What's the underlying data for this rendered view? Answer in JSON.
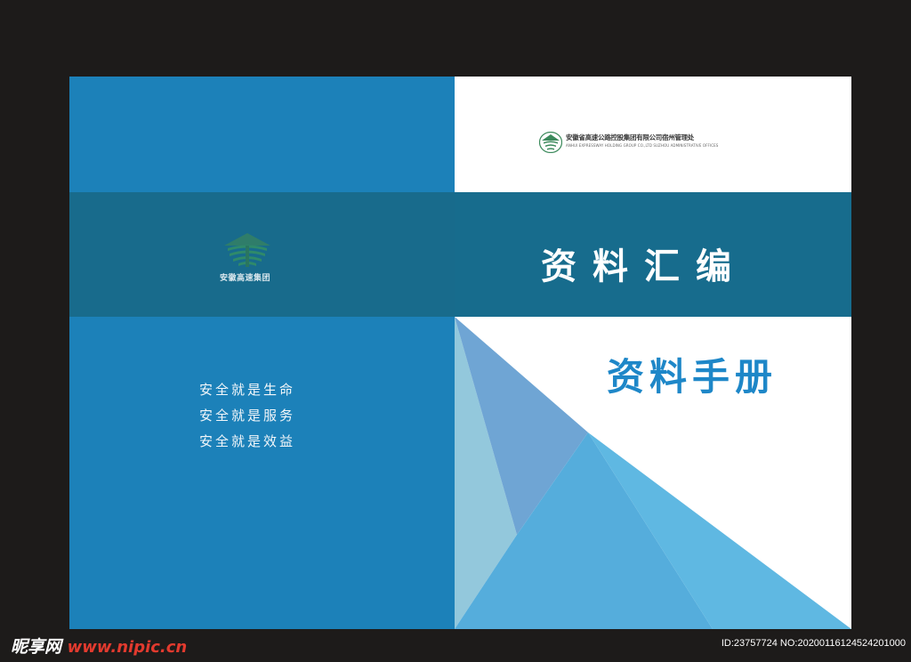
{
  "back_cover": {
    "group_name": "安徽高速集团",
    "slogans": [
      "安全就是生命",
      "安全就是服务",
      "安全就是效益"
    ]
  },
  "front_cover": {
    "publisher_cn": "安徽省高速公路控股集团有限公司宿州管理处",
    "publisher_en": "ANHUI EXPRESSWAY HOLDING GROUP CO.,LTD SUZHOU ADMINISTRATIVE OFFICES",
    "title": "资料汇编",
    "subtitle": "资料手册"
  },
  "watermark": {
    "site_name": "昵享网",
    "site_url": "www.nipic.cn",
    "image_id": "ID:23757724 NO:20200116124524201000"
  },
  "colors": {
    "background": "#1d1b1a",
    "back_blue": "#1c81b9",
    "band_teal": "#176c8d",
    "title_blue": "#1e87c8",
    "logo_green": "#3c8a5c"
  },
  "icons": {
    "back_logo": "expressway-group-logo-icon",
    "publisher_logo": "expressway-group-logo-icon"
  }
}
